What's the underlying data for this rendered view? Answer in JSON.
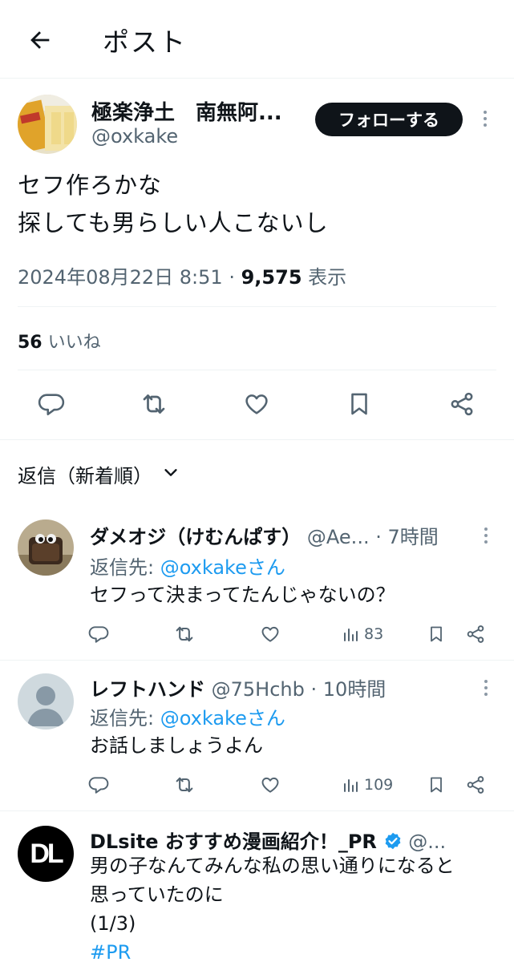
{
  "header": {
    "title": "ポスト"
  },
  "post": {
    "author_name": "極楽浄土　南無阿...",
    "author_handle": "@oxkake",
    "follow_label": "フォローする",
    "text": "セフ作ろかな\n探しても男らしい人こないし",
    "date": "2024年08月22日 8:51",
    "sep": "·",
    "views": "9,575",
    "views_label": "表示",
    "likes_count": "56",
    "likes_label": "いいね"
  },
  "sort": {
    "label": "返信（新着順）"
  },
  "replies": [
    {
      "name": "ダメオジ（けむんぱす）",
      "handle": "@Ae...",
      "time": "· 7時間",
      "reply_prefix": "返信先: ",
      "reply_to": "@oxkakeさん",
      "text": "セフって決まってたんじゃないの？",
      "views": "83"
    },
    {
      "name": "レフトハンド",
      "handle": "@75Hchb",
      "time": "· 10時間",
      "reply_prefix": "返信先: ",
      "reply_to": "@oxkakeさん",
      "text": "お話しましょうよん",
      "views": "109"
    },
    {
      "name": "DLsite おすすめ漫画紹介！_PR",
      "handle": "@...",
      "text": "男の子なんてみんな私の思い通りになると\n思っていたのに\n(1/3)",
      "hashtag": "#PR",
      "avatar_text": "DL"
    }
  ],
  "icons": {
    "back": "arrow-left-icon",
    "reply": "comment-icon",
    "retweet": "retweet-icon",
    "like": "heart-icon",
    "bookmark": "bookmark-icon",
    "share": "share-icon",
    "views": "bar-chart-icon",
    "verified": "verified-badge-icon"
  },
  "colors": {
    "link": "#1d9bf0",
    "text": "#0f1419",
    "muted": "#536471",
    "verified": "#1d9bf0"
  }
}
